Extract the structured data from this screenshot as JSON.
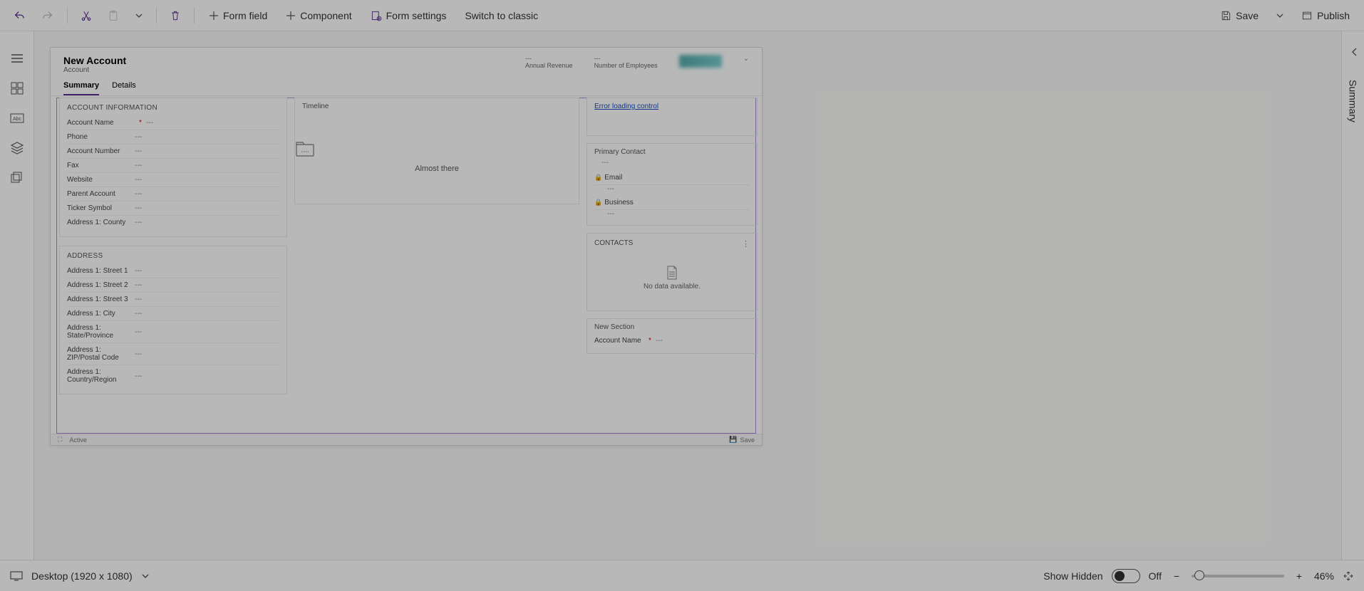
{
  "commandBar": {
    "formField": "Form field",
    "component": "Component",
    "formSettings": "Form settings",
    "switchClassic": "Switch to classic",
    "save": "Save",
    "publish": "Publish"
  },
  "rightPane": {
    "tabLabel": "Summary"
  },
  "preview": {
    "title": "New Account",
    "subtitle": "Account",
    "headerStats": {
      "annualRevenue": {
        "value": "---",
        "label": "Annual Revenue"
      },
      "employees": {
        "value": "---",
        "label": "Number of Employees"
      }
    },
    "tabs": {
      "summary": "Summary",
      "details": "Details"
    },
    "sections": {
      "accountInfo": {
        "title": "ACCOUNT INFORMATION",
        "fields": {
          "accountName": {
            "label": "Account Name",
            "value": "---",
            "required": true
          },
          "phone": {
            "label": "Phone",
            "value": "---"
          },
          "accountNumber": {
            "label": "Account Number",
            "value": "---"
          },
          "fax": {
            "label": "Fax",
            "value": "---"
          },
          "website": {
            "label": "Website",
            "value": "---"
          },
          "parentAccount": {
            "label": "Parent Account",
            "value": "---"
          },
          "ticker": {
            "label": "Ticker Symbol",
            "value": "---"
          },
          "county": {
            "label": "Address 1: County",
            "value": "---"
          }
        }
      },
      "address": {
        "title": "ADDRESS",
        "fields": {
          "s1": {
            "label": "Address 1: Street 1",
            "value": "---"
          },
          "s2": {
            "label": "Address 1: Street 2",
            "value": "---"
          },
          "s3": {
            "label": "Address 1: Street 3",
            "value": "---"
          },
          "city": {
            "label": "Address 1: City",
            "value": "---"
          },
          "state": {
            "label": "Address 1: State/Province",
            "value": "---"
          },
          "zip": {
            "label": "Address 1: ZIP/Postal Code",
            "value": "---"
          },
          "country": {
            "label": "Address 1: Country/Region",
            "value": "---"
          }
        }
      },
      "timeline": {
        "title": "Timeline",
        "message": "Almost there"
      },
      "rightCol": {
        "errorLink": "Error loading control",
        "primaryContact": {
          "title": "Primary Contact",
          "value": "---"
        },
        "email": {
          "label": "Email",
          "value": "---"
        },
        "business": {
          "label": "Business",
          "value": "---"
        },
        "contacts": {
          "title": "CONTACTS",
          "empty": "No data available."
        },
        "newSection": {
          "title": "New Section",
          "accountName": {
            "label": "Account Name",
            "value": "---",
            "required": true
          }
        }
      }
    },
    "footer": {
      "status": "Active",
      "save": "Save"
    }
  },
  "statusBar": {
    "viewport": "Desktop (1920 x 1080)",
    "showHiddenLabel": "Show Hidden",
    "showHiddenState": "Off",
    "zoom": "46%"
  }
}
